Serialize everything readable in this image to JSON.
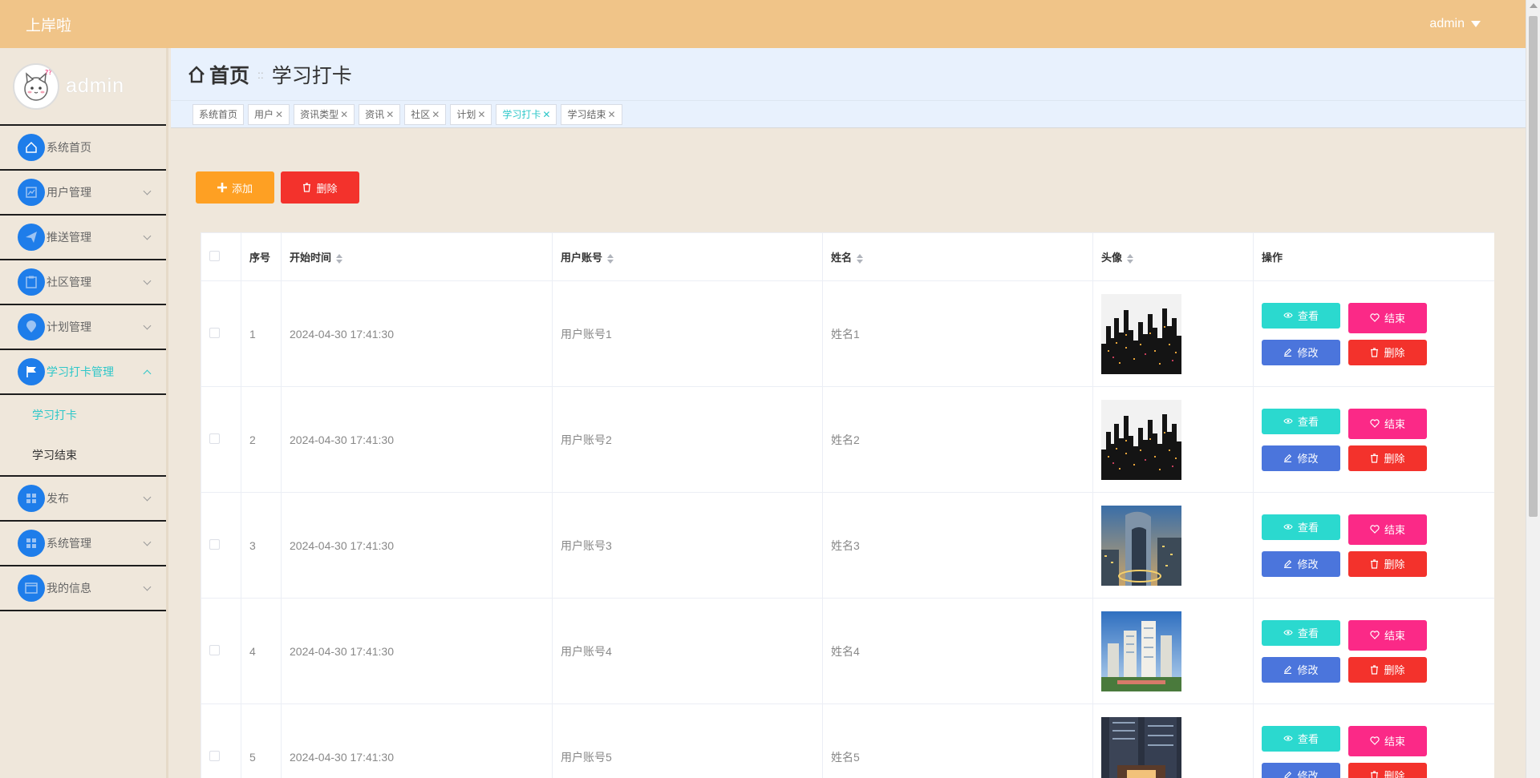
{
  "app": {
    "brand": "上岸啦",
    "user": "admin"
  },
  "sidebar": {
    "profile_name": "admin",
    "items": [
      {
        "label": "系统首页",
        "icon": "home-icon",
        "expandable": false
      },
      {
        "label": "用户管理",
        "icon": "chart-icon",
        "expandable": true
      },
      {
        "label": "推送管理",
        "icon": "send-icon",
        "expandable": true
      },
      {
        "label": "社区管理",
        "icon": "clipboard-icon",
        "expandable": true
      },
      {
        "label": "计划管理",
        "icon": "pin-icon",
        "expandable": true
      },
      {
        "label": "学习打卡管理",
        "icon": "flag-icon",
        "expandable": true,
        "active": true
      },
      {
        "label": "发布",
        "icon": "grid-icon",
        "expandable": true
      },
      {
        "label": "系统管理",
        "icon": "grid-icon",
        "expandable": true
      },
      {
        "label": "我的信息",
        "icon": "card-icon",
        "expandable": true
      }
    ],
    "submenu": [
      {
        "label": "学习打卡",
        "active": true
      },
      {
        "label": "学习结束",
        "active": false
      }
    ]
  },
  "breadcrumb": {
    "home": "首页",
    "current": "学习打卡"
  },
  "tags": [
    {
      "label": "系统首页",
      "closable": false
    },
    {
      "label": "用户",
      "closable": true
    },
    {
      "label": "资讯类型",
      "closable": true
    },
    {
      "label": "资讯",
      "closable": true
    },
    {
      "label": "社区",
      "closable": true
    },
    {
      "label": "计划",
      "closable": true
    },
    {
      "label": "学习打卡",
      "closable": true,
      "active": true
    },
    {
      "label": "学习结束",
      "closable": true
    }
  ],
  "toolbar": {
    "add_label": "添加",
    "delete_label": "删除"
  },
  "table": {
    "headers": {
      "index": "序号",
      "start": "开始时间",
      "account": "用户账号",
      "name": "姓名",
      "avatar": "头像",
      "ops": "操作"
    },
    "rows": [
      {
        "index": "1",
        "start": "2024-04-30 17:41:30",
        "account": "用户账号1",
        "name": "姓名1",
        "img": "city-night"
      },
      {
        "index": "2",
        "start": "2024-04-30 17:41:30",
        "account": "用户账号2",
        "name": "姓名2",
        "img": "city-night"
      },
      {
        "index": "3",
        "start": "2024-04-30 17:41:30",
        "account": "用户账号3",
        "name": "姓名3",
        "img": "city-dusk"
      },
      {
        "index": "4",
        "start": "2024-04-30 17:41:30",
        "account": "用户账号4",
        "name": "姓名4",
        "img": "city-day"
      },
      {
        "index": "5",
        "start": "2024-04-30 17:41:30",
        "account": "用户账号5",
        "name": "姓名5",
        "img": "tower-evening"
      }
    ],
    "actions": {
      "view": "查看",
      "end": "结束",
      "edit": "修改",
      "remove": "删除"
    }
  },
  "colors": {
    "topbar": "#f0c488",
    "accent": "#2ec7c9",
    "menu_icon": "#1e7dea",
    "add": "#fea023",
    "danger": "#f3322c",
    "view": "#2bd9cf",
    "end": "#fb2987",
    "edit": "#4b75dc"
  }
}
